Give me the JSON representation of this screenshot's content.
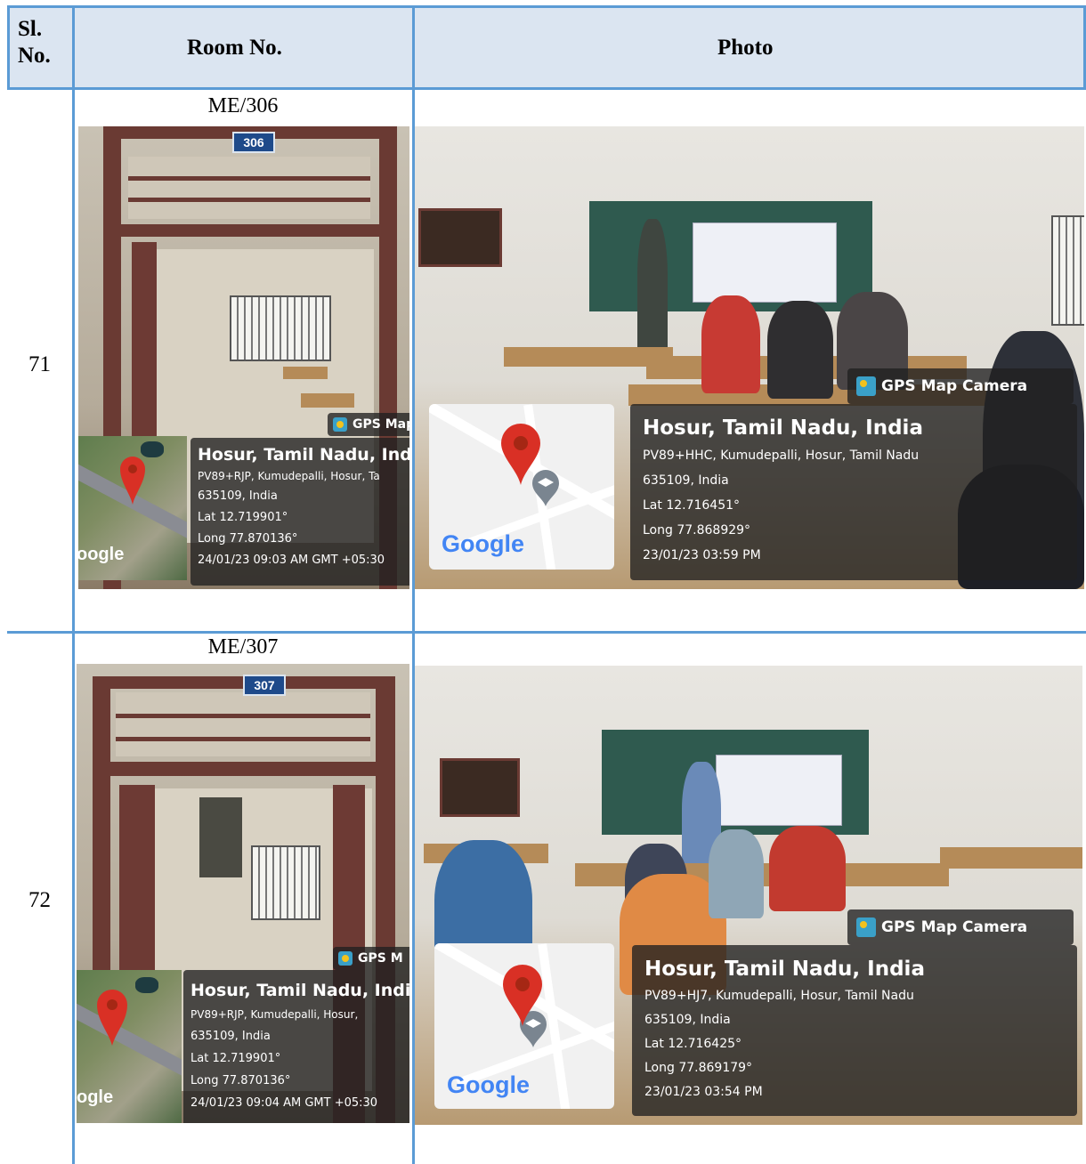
{
  "table": {
    "headers": {
      "sl_no": "Sl.\nNo.",
      "room_no": "Room No.",
      "photo": "Photo"
    },
    "rows": [
      {
        "sl_no": "71",
        "room": "ME/306",
        "door_plate": "306",
        "door_gps": {
          "badge": "GPS Map",
          "title": "Hosur, Tamil Nadu, India",
          "address": "PV89+RJP, Kumudepalli, Hosur, Ta",
          "postal": "635109, India",
          "lat": "Lat 12.719901°",
          "long": "Long 77.870136°",
          "datetime": "24/01/23 09:03 AM GMT +05:30",
          "map_logo": "oogle"
        },
        "class_gps": {
          "badge": "GPS Map Camera",
          "title": "Hosur, Tamil Nadu, India",
          "address": "PV89+HHC, Kumudepalli, Hosur, Tamil Nadu",
          "postal": "635109, India",
          "lat": "Lat 12.716451°",
          "long": "Long 77.868929°",
          "datetime": "23/01/23 03:59 PM",
          "map_logo": "Google"
        }
      },
      {
        "sl_no": "72",
        "room": "ME/307",
        "door_plate": "307",
        "door_gps": {
          "badge": "GPS M",
          "title": "Hosur, Tamil Nadu, Indi",
          "address": "PV89+RJP, Kumudepalli, Hosur,",
          "postal": "635109, India",
          "lat": "Lat 12.719901°",
          "long": "Long 77.870136°",
          "datetime": "24/01/23 09:04 AM GMT +05:30",
          "map_logo": "ogle"
        },
        "class_gps": {
          "badge": "GPS Map Camera",
          "title": "Hosur, Tamil Nadu, India",
          "address": "PV89+HJ7, Kumudepalli, Hosur, Tamil Nadu",
          "postal": "635109, India",
          "lat": "Lat 12.716425°",
          "long": "Long 77.869179°",
          "datetime": "23/01/23 03:54 PM",
          "map_logo": "Google"
        }
      }
    ]
  },
  "colors": {
    "grid": "#5b9bd5",
    "header_bg": "#dbe5f1",
    "pin": "#d93025"
  },
  "icons": [
    "map-pin-icon",
    "gps-camera-icon",
    "graduation-cap-icon"
  ]
}
